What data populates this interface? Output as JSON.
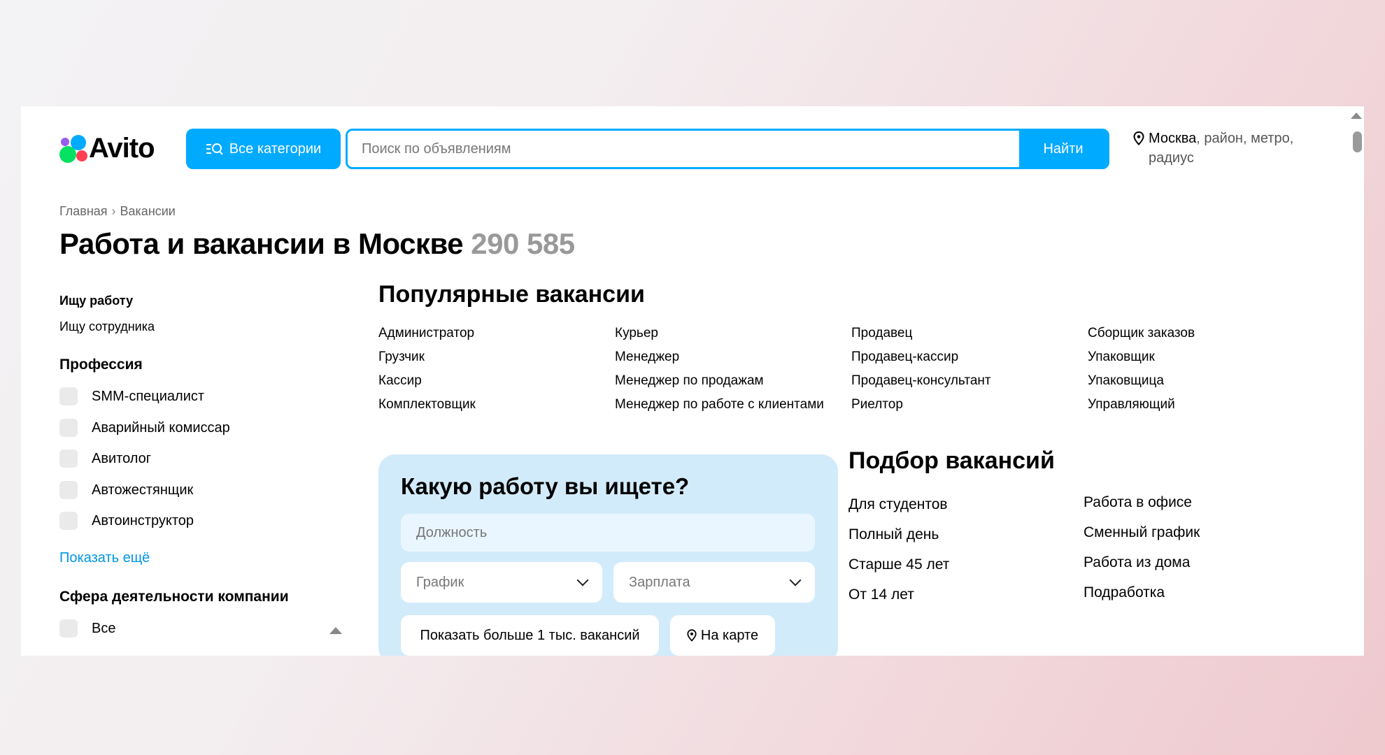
{
  "header": {
    "logo_text": "Avito",
    "categories_label": "Все категории",
    "search_placeholder": "Поиск по объявлениям",
    "search_button": "Найти",
    "location_city": "Москва",
    "location_rest": ", район, метро, радиус"
  },
  "breadcrumb": {
    "items": [
      "Главная",
      "Вакансии"
    ]
  },
  "page": {
    "title": "Работа и вакансии в Москве",
    "count": "290 585"
  },
  "sidebar": {
    "links": [
      "Ищу работу",
      "Ищу сотрудника"
    ],
    "profession_heading": "Профессия",
    "professions": [
      "SMM-специалист",
      "Аварийный комиссар",
      "Авитолог",
      "Автожестянщик",
      "Автоинструктор"
    ],
    "show_more": "Показать ещё",
    "sphere_heading": "Сфера деятельности компании",
    "sphere_items": [
      "Все"
    ]
  },
  "popular": {
    "title": "Популярные вакансии",
    "items": [
      "Администратор",
      "Курьер",
      "Продавец",
      "Сборщик заказов",
      "Грузчик",
      "Менеджер",
      "Продавец-кассир",
      "Упаковщик",
      "Кассир",
      "Менеджер по продажам",
      "Продавец-консультант",
      "Упаковщица",
      "Комплектовщик",
      "Менеджер по работе с клиентами",
      "Риелтор",
      "Управляющий"
    ]
  },
  "search_card": {
    "title": "Какую работу вы ищете?",
    "position_placeholder": "Должность",
    "schedule_label": "График",
    "salary_label": "Зарплата",
    "show_more_button": "Показать больше 1 тыс. вакансий",
    "map_button": "На карте"
  },
  "selection": {
    "title": "Подбор вакансий",
    "left": [
      "Для студентов",
      "Полный день",
      "Старше 45 лет",
      "От 14 лет"
    ],
    "right": [
      "Работа в офисе",
      "Сменный график",
      "Работа из дома",
      "Подработка"
    ]
  },
  "colors": {
    "accent": "#00aaff",
    "link": "#0096e6",
    "card_bg": "#d2ebfb"
  }
}
